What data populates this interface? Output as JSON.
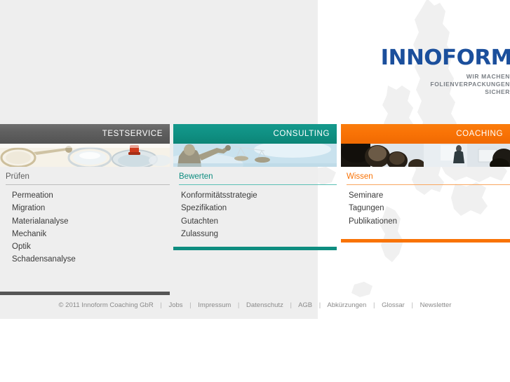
{
  "brand": {
    "logo_text": "INNOFORM",
    "tagline_line1": "WIR MACHEN",
    "tagline_line2": "FOLIENVERPACKUNGEN",
    "tagline_line3": "SICHER",
    "logo_color": "#1b4f9c",
    "tagline_color": "#7a7f85"
  },
  "sections": [
    {
      "bar_label": "TESTSERVICE",
      "bar_color": "#5b5b5b",
      "heading": "Prüfen",
      "heading_color": "#5d5d5d",
      "photo_alt": "laboratory-glassware-photo",
      "links": [
        "Permeation",
        "Migration",
        "Materialanalyse",
        "Mechanik",
        "Optik",
        "Schadensanalyse"
      ]
    },
    {
      "bar_label": "CONSULTING",
      "bar_color": "#0f9184",
      "heading": "Bewerten",
      "heading_color": "#0e8d80",
      "photo_alt": "lady-justice-statue-photo",
      "links": [
        "Konformitätsstrategie",
        "Spezifikation",
        "Gutachten",
        "Zulassung"
      ]
    },
    {
      "bar_label": "COACHING",
      "bar_color": "#f97306",
      "heading": "Wissen",
      "heading_color": "#f97306",
      "photo_alt": "seminar-audience-photo",
      "links": [
        "Seminare",
        "Tagungen",
        "Publikationen"
      ]
    }
  ],
  "footer": {
    "copyright": "© 2011 Innoform Coaching GbR",
    "separator": "|",
    "links": [
      "Jobs",
      "Impressum",
      "Datenschutz",
      "AGB",
      "Abkürzungen",
      "Glossar",
      "Newsletter"
    ]
  },
  "background": {
    "left_panel_color": "#eeeeee",
    "right_panel_color": "#ffffff",
    "map_color": "#f0f0f0",
    "map_alt": "europe-map-watermark"
  }
}
